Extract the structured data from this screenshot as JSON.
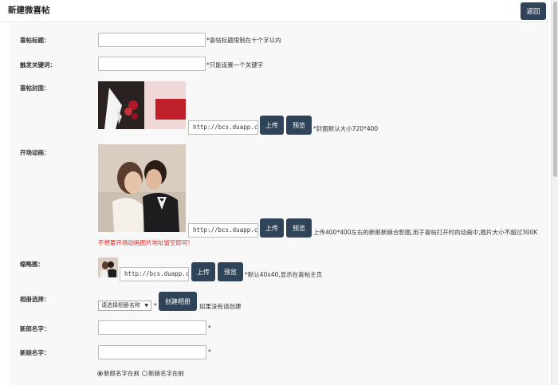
{
  "header": {
    "title": "新建微喜帖",
    "back_label": "返回"
  },
  "fields": {
    "title": {
      "label": "喜帖标题：",
      "value": "",
      "hint": "*喜帖标题限制在十个字以内"
    },
    "keyword": {
      "label": "触发关键词：",
      "value": "",
      "hint": "*只能设置一个关键字"
    },
    "cover": {
      "label": "喜帖封面：",
      "url": "http://bcs.duapp.com/",
      "upload_label": "上传",
      "preview_label": "预览",
      "hint": "*封面默认大小720*400"
    },
    "intro": {
      "label": "开场动画：",
      "url": "http://bcs.duapp.com/",
      "upload_label": "上传",
      "preview_label": "预览",
      "hint": "上传400*400左右的新郎新娘合影图,用于喜帖打开时的动画中,图片大小不超过300K",
      "warning": "不想要开场动画图片地址留空即可!"
    },
    "thumb": {
      "label": "缩略图：",
      "url": "http://bcs.duapp.com/",
      "upload_label": "上传",
      "preview_label": "预览",
      "hint": "*默认40x40,显示在喜帖主页"
    },
    "album": {
      "label": "相册选择：",
      "selected": "请选择相册名称",
      "star": "*",
      "create_label": "创建相册",
      "hint": "如果没有请创建"
    },
    "groom": {
      "label": "新郎名字：",
      "value": "",
      "star": "*"
    },
    "bride": {
      "label": "新娘名字：",
      "value": "",
      "star": "*"
    },
    "order": {
      "options": [
        "新郎名字在前",
        "新娘名字在前"
      ],
      "selected": 0
    }
  }
}
